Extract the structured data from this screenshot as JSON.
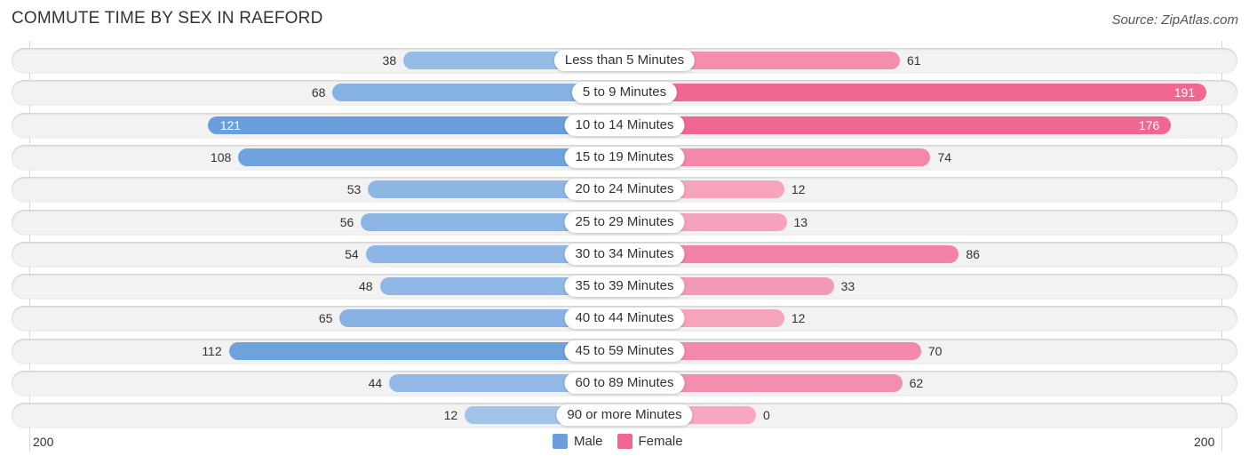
{
  "title": "COMMUTE TIME BY SEX IN RAEFORD",
  "source": "Source: ZipAtlas.com",
  "colors": {
    "male": "#6a9fdc",
    "male_light": "#a9c8ec",
    "female": "#f06892",
    "female_light": "#f7a8c0"
  },
  "chart_data": {
    "type": "bar",
    "orientation": "horizontal-diverging",
    "title": "COMMUTE TIME BY SEX IN RAEFORD",
    "categories": [
      "Less than 5 Minutes",
      "5 to 9 Minutes",
      "10 to 14 Minutes",
      "15 to 19 Minutes",
      "20 to 24 Minutes",
      "25 to 29 Minutes",
      "30 to 34 Minutes",
      "35 to 39 Minutes",
      "40 to 44 Minutes",
      "45 to 59 Minutes",
      "60 to 89 Minutes",
      "90 or more Minutes"
    ],
    "series": [
      {
        "name": "Male",
        "values": [
          38,
          68,
          121,
          108,
          53,
          56,
          54,
          48,
          65,
          112,
          44,
          12
        ]
      },
      {
        "name": "Female",
        "values": [
          61,
          191,
          176,
          74,
          12,
          13,
          86,
          33,
          12,
          70,
          62,
          0
        ]
      }
    ],
    "axis": {
      "left_label": "200",
      "right_label": "200",
      "max": 200
    },
    "legend": [
      "Male",
      "Female"
    ],
    "legend_position": "bottom-center"
  }
}
